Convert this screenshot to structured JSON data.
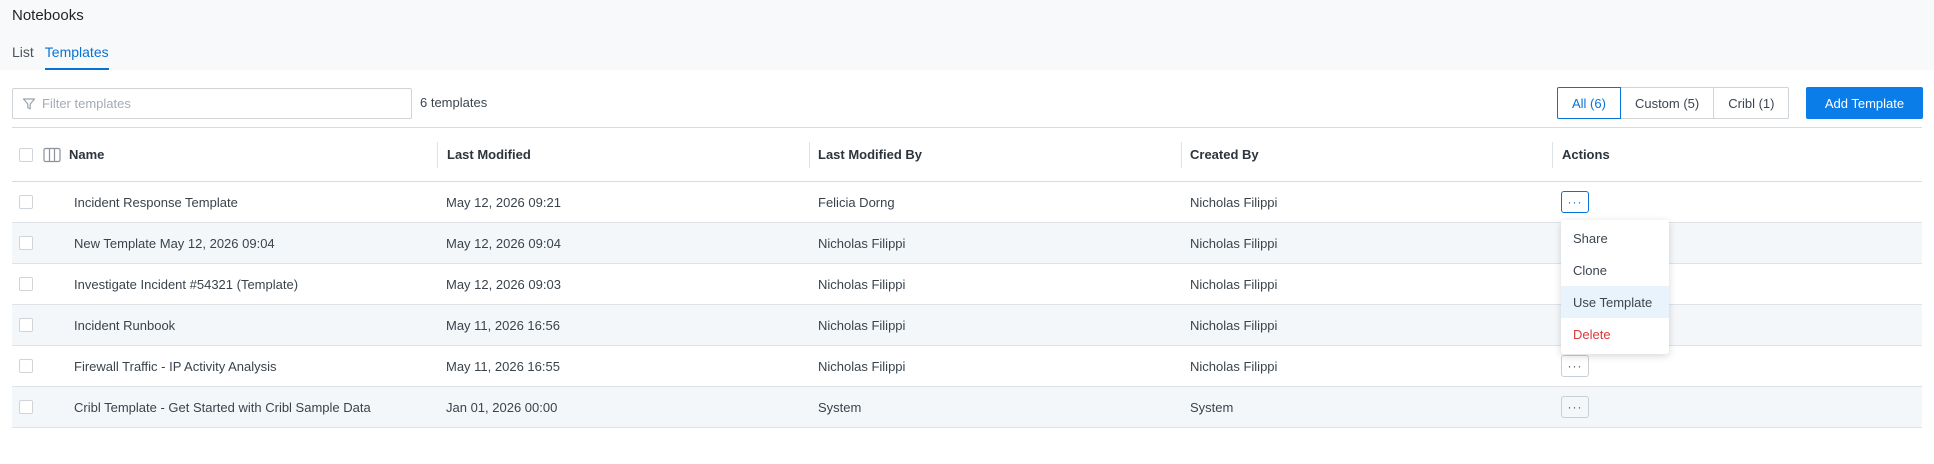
{
  "page": {
    "title": "Notebooks",
    "tabs": [
      {
        "label": "List",
        "active": false
      },
      {
        "label": "Templates",
        "active": true
      }
    ]
  },
  "toolbar": {
    "filter_placeholder": "Filter templates",
    "filter_value": "",
    "count_label": "6 templates",
    "segments": [
      {
        "label": "All (6)",
        "active": true
      },
      {
        "label": "Custom (5)",
        "active": false
      },
      {
        "label": "Cribl (1)",
        "active": false
      }
    ],
    "add_label": "Add Template"
  },
  "table": {
    "columns": [
      "Name",
      "Last Modified",
      "Last Modified By",
      "Created By",
      "Actions"
    ],
    "rows": [
      {
        "name": "Incident Response Template",
        "modified": "May 12, 2026 09:21",
        "modified_by": "Felicia Dorng",
        "created_by": "Nicholas Filippi"
      },
      {
        "name": "New Template May 12, 2026 09:04",
        "modified": "May 12, 2026 09:04",
        "modified_by": "Nicholas Filippi",
        "created_by": "Nicholas Filippi"
      },
      {
        "name": "Investigate Incident #54321 (Template)",
        "modified": "May 12, 2026 09:03",
        "modified_by": "Nicholas Filippi",
        "created_by": "Nicholas Filippi"
      },
      {
        "name": "Incident Runbook",
        "modified": "May 11, 2026 16:56",
        "modified_by": "Nicholas Filippi",
        "created_by": "Nicholas Filippi"
      },
      {
        "name": "Firewall Traffic - IP Activity Analysis",
        "modified": "May 11, 2026 16:55",
        "modified_by": "Nicholas Filippi",
        "created_by": "Nicholas Filippi"
      },
      {
        "name": "Cribl Template - Get Started with Cribl Sample Data",
        "modified": "Jan 01, 2026 00:00",
        "modified_by": "System",
        "created_by": "System"
      }
    ],
    "more_label": "···"
  },
  "menu": {
    "items": [
      "Share",
      "Clone",
      "Use Template",
      "Delete"
    ]
  },
  "colors": {
    "accent": "#0873d6",
    "danger": "#d93a3a"
  }
}
